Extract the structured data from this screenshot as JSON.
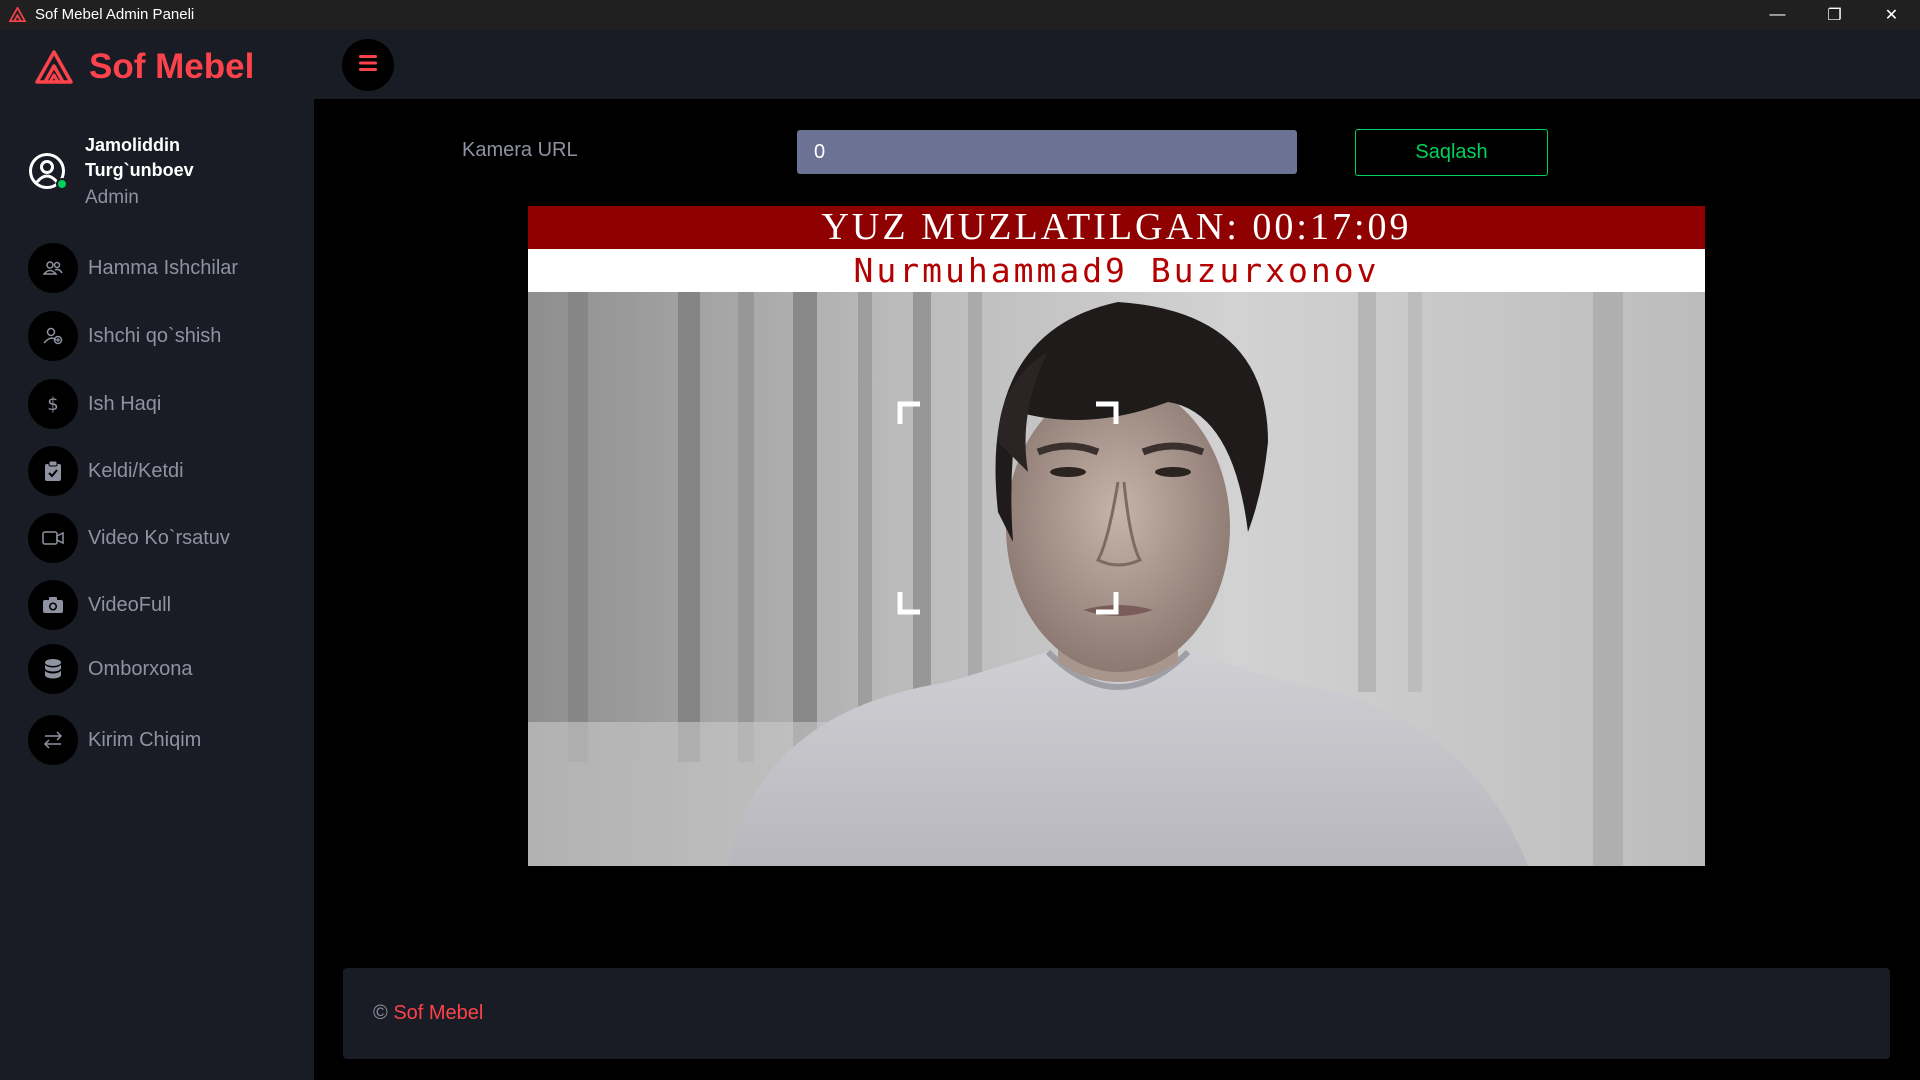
{
  "window": {
    "title": "Sof Mebel Admin Paneli",
    "minimize_glyph": "—",
    "restore_glyph": "❐",
    "close_glyph": "✕"
  },
  "brand": {
    "name": "Sof Mebel",
    "accent_color": "#fc424a"
  },
  "profile": {
    "name": "Jamoliddin Turg`unboev",
    "role": "Admin",
    "status_color": "#00d25b"
  },
  "sidebar": {
    "items": [
      {
        "label": "Hamma Ishchilar",
        "icon": "users-icon"
      },
      {
        "label": "Ishchi qo`shish",
        "icon": "user-add-icon"
      },
      {
        "label": "Ish Haqi",
        "icon": "dollar-icon"
      },
      {
        "label": "Keldi/Ketdi",
        "icon": "clipboard-check-icon"
      },
      {
        "label": "Video Ko`rsatuv",
        "icon": "video-camera-icon"
      },
      {
        "label": "VideoFull",
        "icon": "camera-icon"
      },
      {
        "label": "Omborxona",
        "icon": "database-icon"
      },
      {
        "label": "Kirim Chiqim",
        "icon": "swap-arrows-icon"
      }
    ]
  },
  "camera": {
    "label": "Kamera URL",
    "value": "0",
    "save_label": "Saqlash",
    "save_color": "#00d25b"
  },
  "video": {
    "status_banner": "YUZ MUZLATILGAN: 00:17:09",
    "person_name": "Nurmuhammad9 Buzurxonov"
  },
  "footer": {
    "copyright_symbol": "©",
    "brand": "Sof Mebel"
  }
}
